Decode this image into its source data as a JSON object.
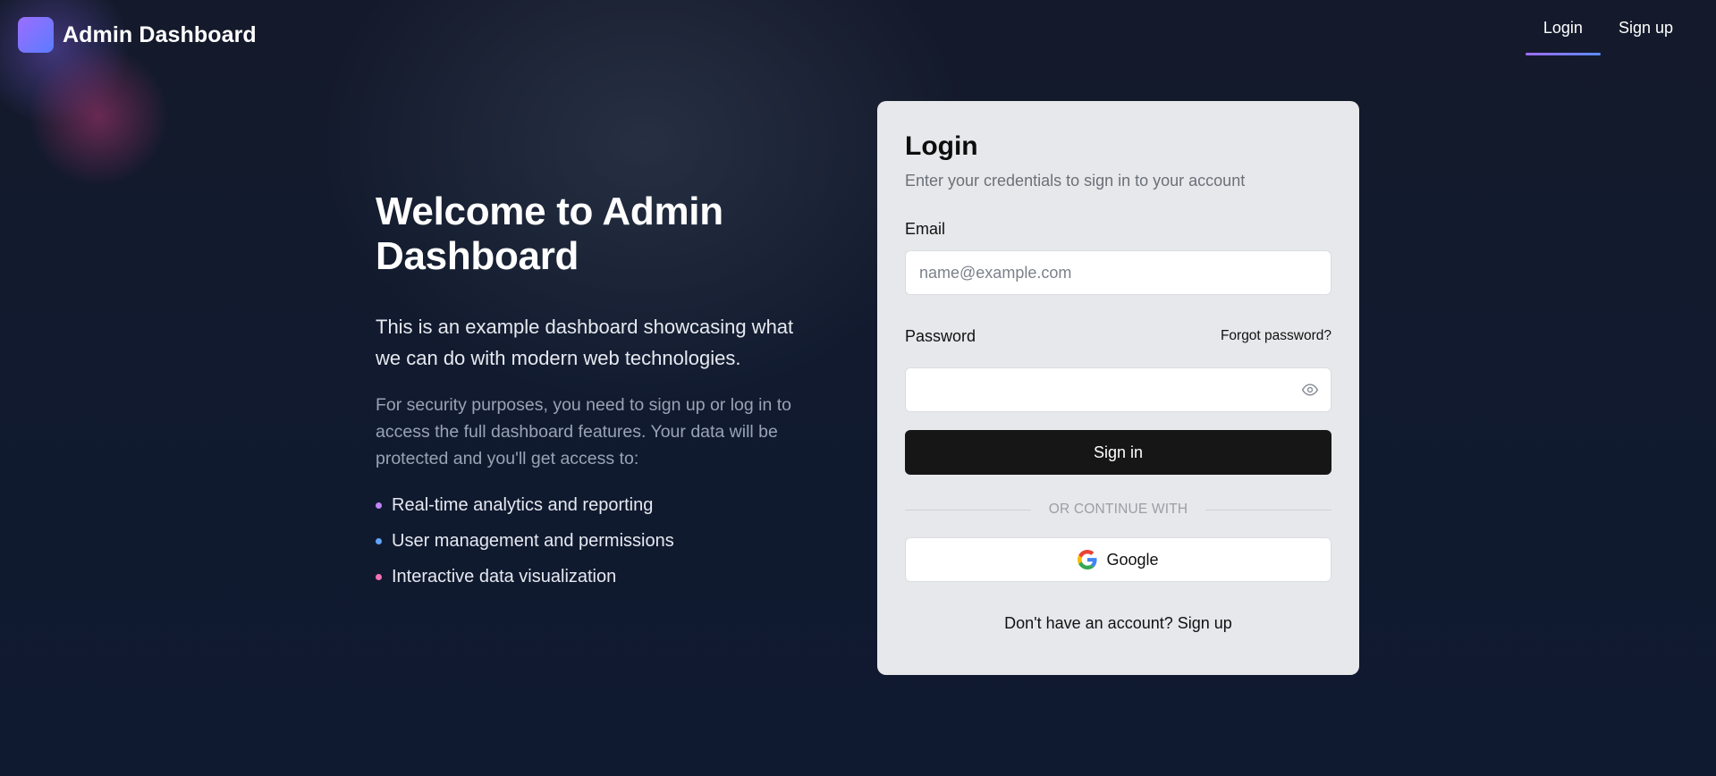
{
  "header": {
    "brand_title": "Admin Dashboard",
    "nav": [
      {
        "label": "Login",
        "active": true
      },
      {
        "label": "Sign up",
        "active": false
      }
    ]
  },
  "intro": {
    "title": "Welcome to Admin Dashboard",
    "lead": "This is an example dashboard showcasing what we can do with modern web technologies.",
    "body": "For security purposes, you need to sign up or log in to access the full dashboard features. Your data will be protected and you'll get access to:",
    "features": [
      {
        "label": "Real-time analytics and reporting",
        "bullet_color": "#c084fc"
      },
      {
        "label": "User management and permissions",
        "bullet_color": "#60a5fa"
      },
      {
        "label": "Interactive data visualization",
        "bullet_color": "#f472b6"
      }
    ]
  },
  "login_card": {
    "title": "Login",
    "subtitle": "Enter your credentials to sign in to your account",
    "email_label": "Email",
    "email_placeholder": "name@example.com",
    "email_value": "",
    "password_label": "Password",
    "password_value": "",
    "forgot_password": "Forgot password?",
    "password_toggle_icon": "eye-icon",
    "signin_label": "Sign in",
    "divider_text": "OR CONTINUE WITH",
    "google_label": "Google",
    "google_icon": "google-icon",
    "signup_prompt": "Don't have an account?",
    "signup_link": "Sign up"
  },
  "colors": {
    "background": "#121a2d",
    "accent_gradient_start": "#a06bff",
    "accent_gradient_end": "#5b8cff",
    "card_background": "#e7e8eb",
    "primary_button": "#161616"
  }
}
